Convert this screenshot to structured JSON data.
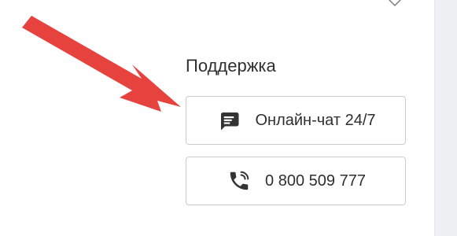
{
  "support": {
    "title": "Поддержка",
    "chat_label": "Онлайн-чат 24/7",
    "phone_label": "0 800 509 777",
    "chat_icon": "chat-icon",
    "phone_icon": "phone-icon"
  },
  "annotation": {
    "arrow_icon": "arrow-icon",
    "arrow_color": "#e53935"
  }
}
